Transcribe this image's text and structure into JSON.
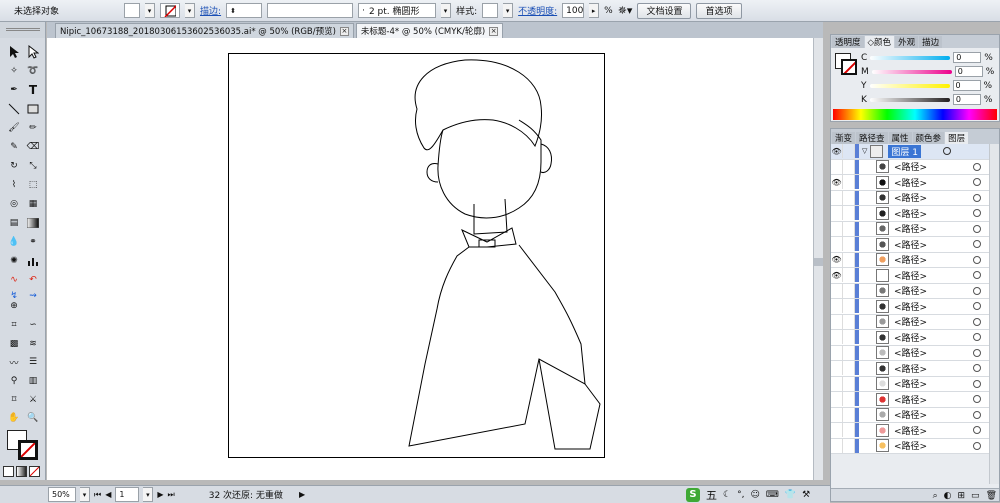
{
  "control_bar": {
    "selection_status": "未选择对象",
    "stroke_label": "描边:",
    "brush_value": "2 pt. 椭圆形",
    "style_label": "样式:",
    "opacity_label": "不透明度:",
    "opacity_value": "100",
    "opacity_unit": "%",
    "doc_setup_button": "文档设置",
    "preferences_button": "首选项"
  },
  "doc_tabs": [
    {
      "label": "Nipic_10673188_20180306153602536035.ai* @ 50% (RGB/预览)",
      "close": "×"
    },
    {
      "label": "未标题-4* @ 50% (CMYK/轮廓)",
      "close": "×"
    }
  ],
  "color_panel": {
    "tabs": [
      "透明度",
      "◇颜色",
      "外观",
      "描边"
    ],
    "channels": [
      {
        "label": "C",
        "value": "0",
        "unit": "%",
        "color": "#00aeef"
      },
      {
        "label": "M",
        "value": "0",
        "unit": "%",
        "color": "#ec008c"
      },
      {
        "label": "Y",
        "value": "0",
        "unit": "%",
        "color": "#fff200"
      },
      {
        "label": "K",
        "value": "0",
        "unit": "%",
        "color": "#231f20"
      }
    ]
  },
  "layers_panel": {
    "tabs": [
      "渐变",
      "路径查",
      "属性",
      "颜色参",
      "图层"
    ],
    "layer_name": "图层 1",
    "items": [
      "<路径>",
      "<路径>",
      "<路径>",
      "<路径>",
      "<路径>",
      "<路径>",
      "<路径>",
      "<路径>",
      "<路径>",
      "<路径>",
      "<路径>",
      "<路径>",
      "<路径>",
      "<路径>",
      "<路径>",
      "<路径>",
      "<路径>",
      "<路径>",
      "<路径>"
    ],
    "visible_rows": [
      1,
      6,
      7
    ]
  },
  "status_bar": {
    "zoom": "50%",
    "page": "1",
    "message": "32 次还原: 无重做"
  },
  "ime_bar": {
    "logo": "S",
    "mode": "五"
  },
  "colors": {
    "selection_blue": "#3a75d4",
    "ime_green": "#3fa935"
  }
}
